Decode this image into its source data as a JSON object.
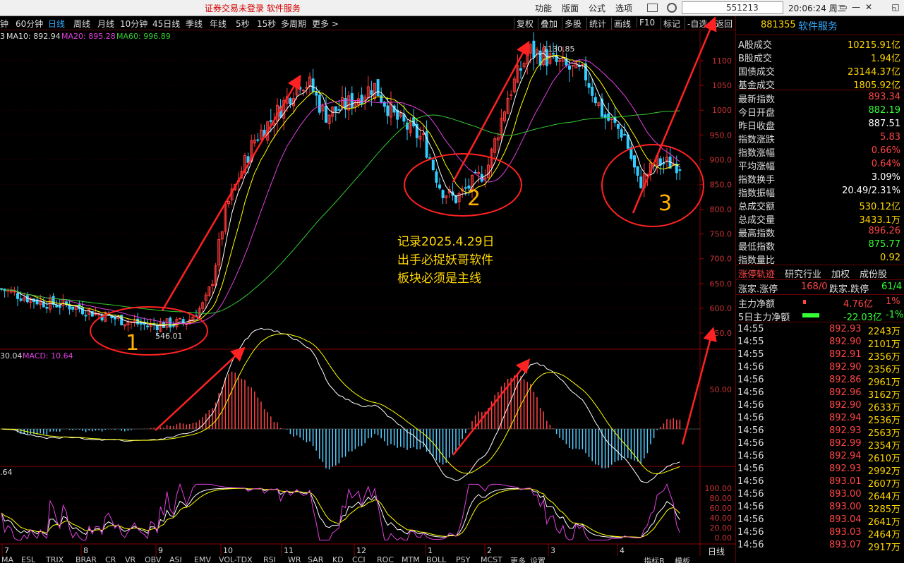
{
  "topbar": {
    "warning": "证券交易未登录   软件服务",
    "menu": [
      "功能",
      "版面",
      "公式",
      "选项"
    ],
    "search_value": "551213",
    "clock": "20:06:24 周二",
    "win_buttons": [
      "▭",
      "—",
      "✕",
      "◱"
    ]
  },
  "toolbar": {
    "periods": [
      "钟",
      "60分钟",
      "日线",
      "周线",
      "月线",
      "10分钟",
      "45日线",
      "季线",
      "年线",
      "5秒",
      "15秒",
      "多周期",
      "更多 >"
    ],
    "active_period": "日线",
    "right_tools": [
      "复权",
      "叠加",
      "多股",
      "统计",
      "画线",
      "F10",
      "标记",
      "-自选",
      "返回"
    ]
  },
  "indicator_legend": {
    "ma10": "MA10: 892.94",
    "ma20": "MA20: 895.28",
    "ma60": "MA60: 996.89",
    "macd": "MACD: 10.64",
    "macd_prefix": "30.04",
    "kdj_prefix": ".64",
    "ma_prefix": "3"
  },
  "labels": {
    "high_mark": "1130.85",
    "low_mark": "546.01",
    "circle1": "1",
    "circle2": "2",
    "circle3": "3",
    "annotation": [
      "记录2025.4.29日",
      "出手必捉妖哥软件",
      "板块必须是主线"
    ]
  },
  "price_axis": [
    "1100",
    "1050",
    "1000",
    "950.0",
    "900.0",
    "850.0",
    "800.0",
    "750.0",
    "700.0",
    "650.0",
    "600.0",
    "550.0"
  ],
  "macd_axis": [
    "50.00"
  ],
  "kdj_axis": [
    "100.00",
    "80.00",
    "60.00",
    "40.00",
    "20.00",
    "0.00"
  ],
  "month_axis": [
    "7",
    "8",
    "9",
    "10",
    "11",
    "12",
    "1",
    "2",
    "3",
    "4"
  ],
  "period_label": "日线",
  "bottom_tabs": [
    "MA",
    "ESL",
    "TRIX",
    "BRAR",
    "CR",
    "VR",
    "OBV",
    "ASI",
    "EMV",
    "VOL-TDX",
    "RSI",
    "WR",
    "SAR",
    "KD",
    "CCI",
    "ROC",
    "MTM",
    "BOLL",
    "PSY",
    "MCST",
    "更多",
    "设置"
  ],
  "bottom_right": [
    "指标B",
    "模板"
  ],
  "panel": {
    "code": "881355",
    "name": "软件服务",
    "market": [
      {
        "k": "A股成交",
        "v": "10215.91亿"
      },
      {
        "k": "B股成交",
        "v": "1.94亿"
      },
      {
        "k": "国债成交",
        "v": "23144.37亿"
      },
      {
        "k": "基金成交",
        "v": "1805.92亿"
      }
    ],
    "stats": [
      {
        "k": "最新指数",
        "v": "893.34",
        "c": "#ff4545"
      },
      {
        "k": "今日开盘",
        "v": "882.19",
        "c": "#3f3"
      },
      {
        "k": "昨日收盘",
        "v": "887.51",
        "c": "#fff"
      },
      {
        "k": "指数涨跌",
        "v": "5.83",
        "c": "#ff4545"
      },
      {
        "k": "指数涨幅",
        "v": "0.66%",
        "c": "#ff4545"
      },
      {
        "k": "平均涨幅",
        "v": "0.64%",
        "c": "#ff4545"
      },
      {
        "k": "指数换手",
        "v": "3.09%",
        "c": "#fff"
      },
      {
        "k": "指数振幅",
        "v": "20.49/2.31%",
        "c": "#fff"
      },
      {
        "k": "总成交额",
        "v": "530.12亿",
        "c": "#ffd700"
      },
      {
        "k": "总成交量",
        "v": "3433.1万",
        "c": "#ffd700"
      },
      {
        "k": "最高指数",
        "v": "896.26",
        "c": "#ff4545"
      },
      {
        "k": "最低指数",
        "v": "875.77",
        "c": "#3f3"
      },
      {
        "k": "指数量比",
        "v": "0.92",
        "c": "#ffd700"
      }
    ],
    "tabs": [
      "涨停轨迹",
      "研究行业",
      "加权",
      "成份股"
    ],
    "limit_row": {
      "k1": "涨家.涨停",
      "v1": "168/0",
      "k2": "跌家.跌停",
      "v2": "61/4"
    },
    "flow": [
      {
        "k": "主力净额",
        "v": "4.76亿",
        "p": "1%",
        "c": "#ff4545"
      },
      {
        "k": "5日主力净额",
        "v": "-22.03亿",
        "p": "-1%",
        "c": "#3f3"
      }
    ],
    "ticks": [
      [
        "14:55",
        "892.93",
        "2243万"
      ],
      [
        "14:55",
        "892.90",
        "2101万"
      ],
      [
        "14:55",
        "892.91",
        "2356万"
      ],
      [
        "14:56",
        "892.90",
        "2356万"
      ],
      [
        "14:56",
        "892.86",
        "2961万"
      ],
      [
        "14:56",
        "892.96",
        "3162万"
      ],
      [
        "14:56",
        "892.90",
        "2633万"
      ],
      [
        "14:56",
        "892.94",
        "2536万"
      ],
      [
        "14:56",
        "892.93",
        "2563万"
      ],
      [
        "14:56",
        "892.99",
        "2354万"
      ],
      [
        "14:56",
        "892.94",
        "2610万"
      ],
      [
        "14:56",
        "892.93",
        "2992万"
      ],
      [
        "14:56",
        "893.01",
        "2607万"
      ],
      [
        "14:56",
        "893.00",
        "2644万"
      ],
      [
        "14:56",
        "893.00",
        "3285万"
      ],
      [
        "14:56",
        "893.04",
        "2641万"
      ],
      [
        "14:56",
        "893.03",
        "2464万"
      ],
      [
        "14:56",
        "893.07",
        "2917万"
      ]
    ]
  }
}
